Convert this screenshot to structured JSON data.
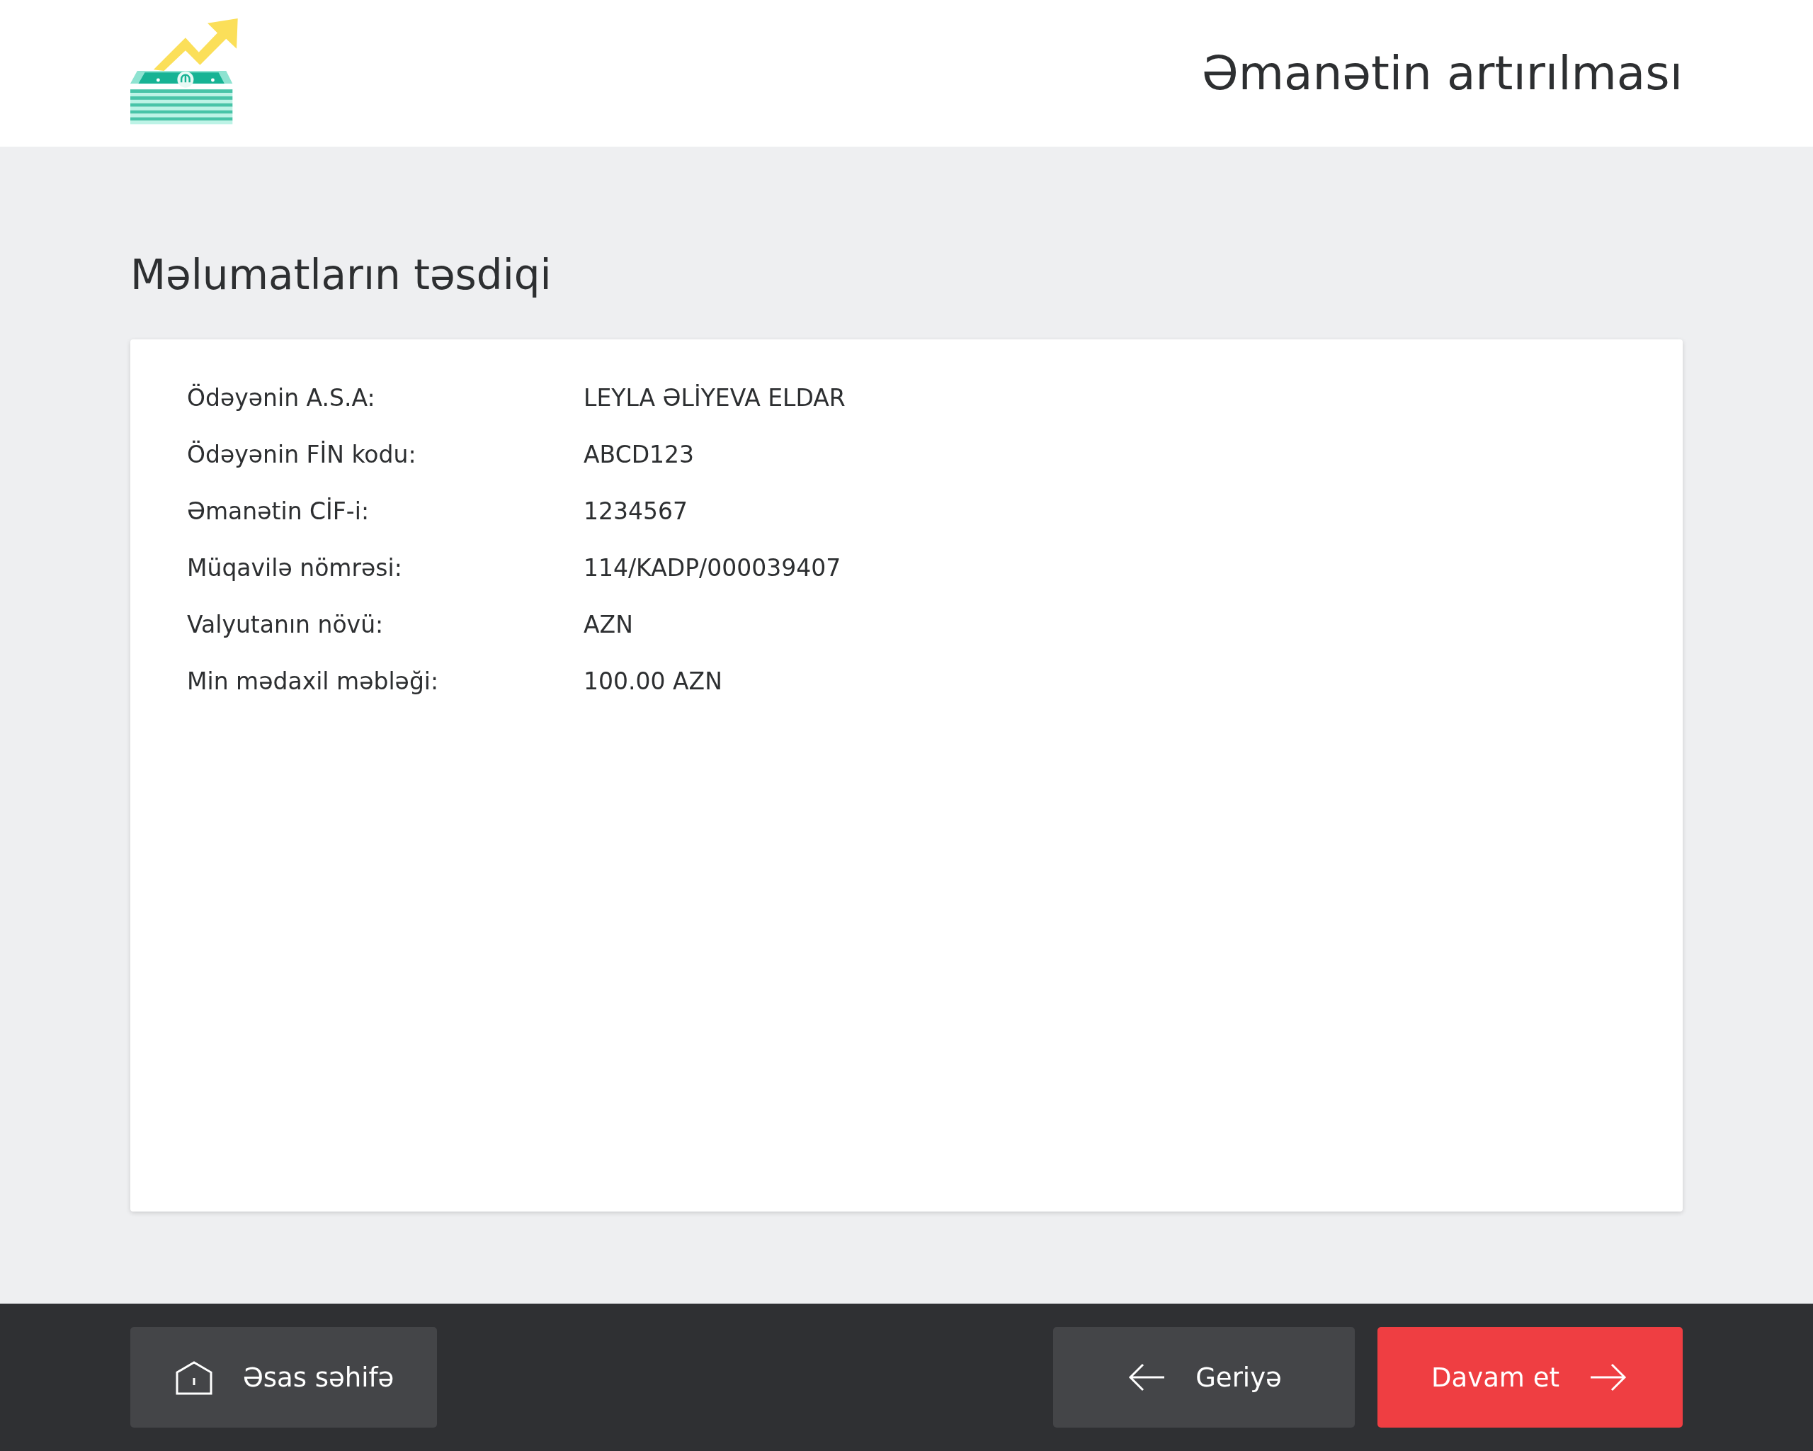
{
  "header": {
    "title": "Əmanətin artırılması"
  },
  "page_title": "Məlumatların təsdiqi",
  "details": [
    {
      "label": "Ödəyənin A.S.A:",
      "value": "LEYLA ƏLİYEVA ELDAR"
    },
    {
      "label": "Ödəyənin FİN kodu:",
      "value": "ABCD123"
    },
    {
      "label": "Əmanətin CİF-i:",
      "value": "1234567"
    },
    {
      "label": "Müqavilə nömrəsi:",
      "value": "114/KADP/000039407"
    },
    {
      "label": "Valyutanın növü:",
      "value": "AZN"
    },
    {
      "label": "Min mədaxil məbləği:",
      "value": "100.00 AZN"
    }
  ],
  "footer": {
    "home": {
      "label": "Əsas səhifə"
    },
    "back": {
      "label": "Geriyə"
    },
    "next": {
      "label": "Davam et"
    }
  }
}
